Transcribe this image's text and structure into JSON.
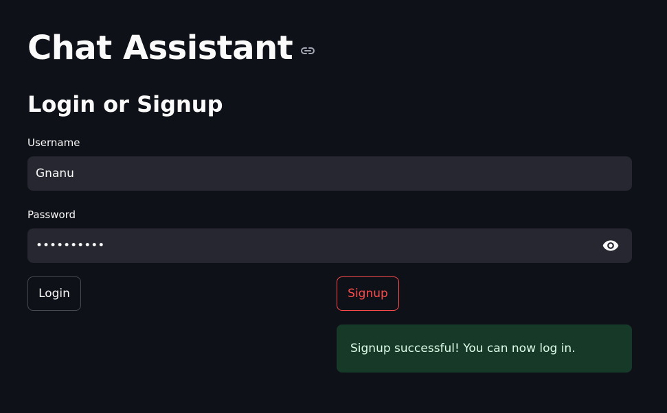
{
  "header": {
    "title": "Chat Assistant",
    "anchor_icon": "link-icon"
  },
  "form": {
    "heading": "Login or Signup",
    "username": {
      "label": "Username",
      "value": "Gnanu"
    },
    "password": {
      "label": "Password",
      "value": "••••••••••",
      "toggle_icon": "eye-icon"
    },
    "buttons": {
      "login_label": "Login",
      "signup_label": "Signup"
    }
  },
  "alert": {
    "type": "success",
    "message": "Signup successful! You can now log in."
  },
  "colors": {
    "background": "#0e1117",
    "input_background": "#262730",
    "accent": "#ff4b4b",
    "success_background": "#173928",
    "success_text": "#dffde9"
  }
}
